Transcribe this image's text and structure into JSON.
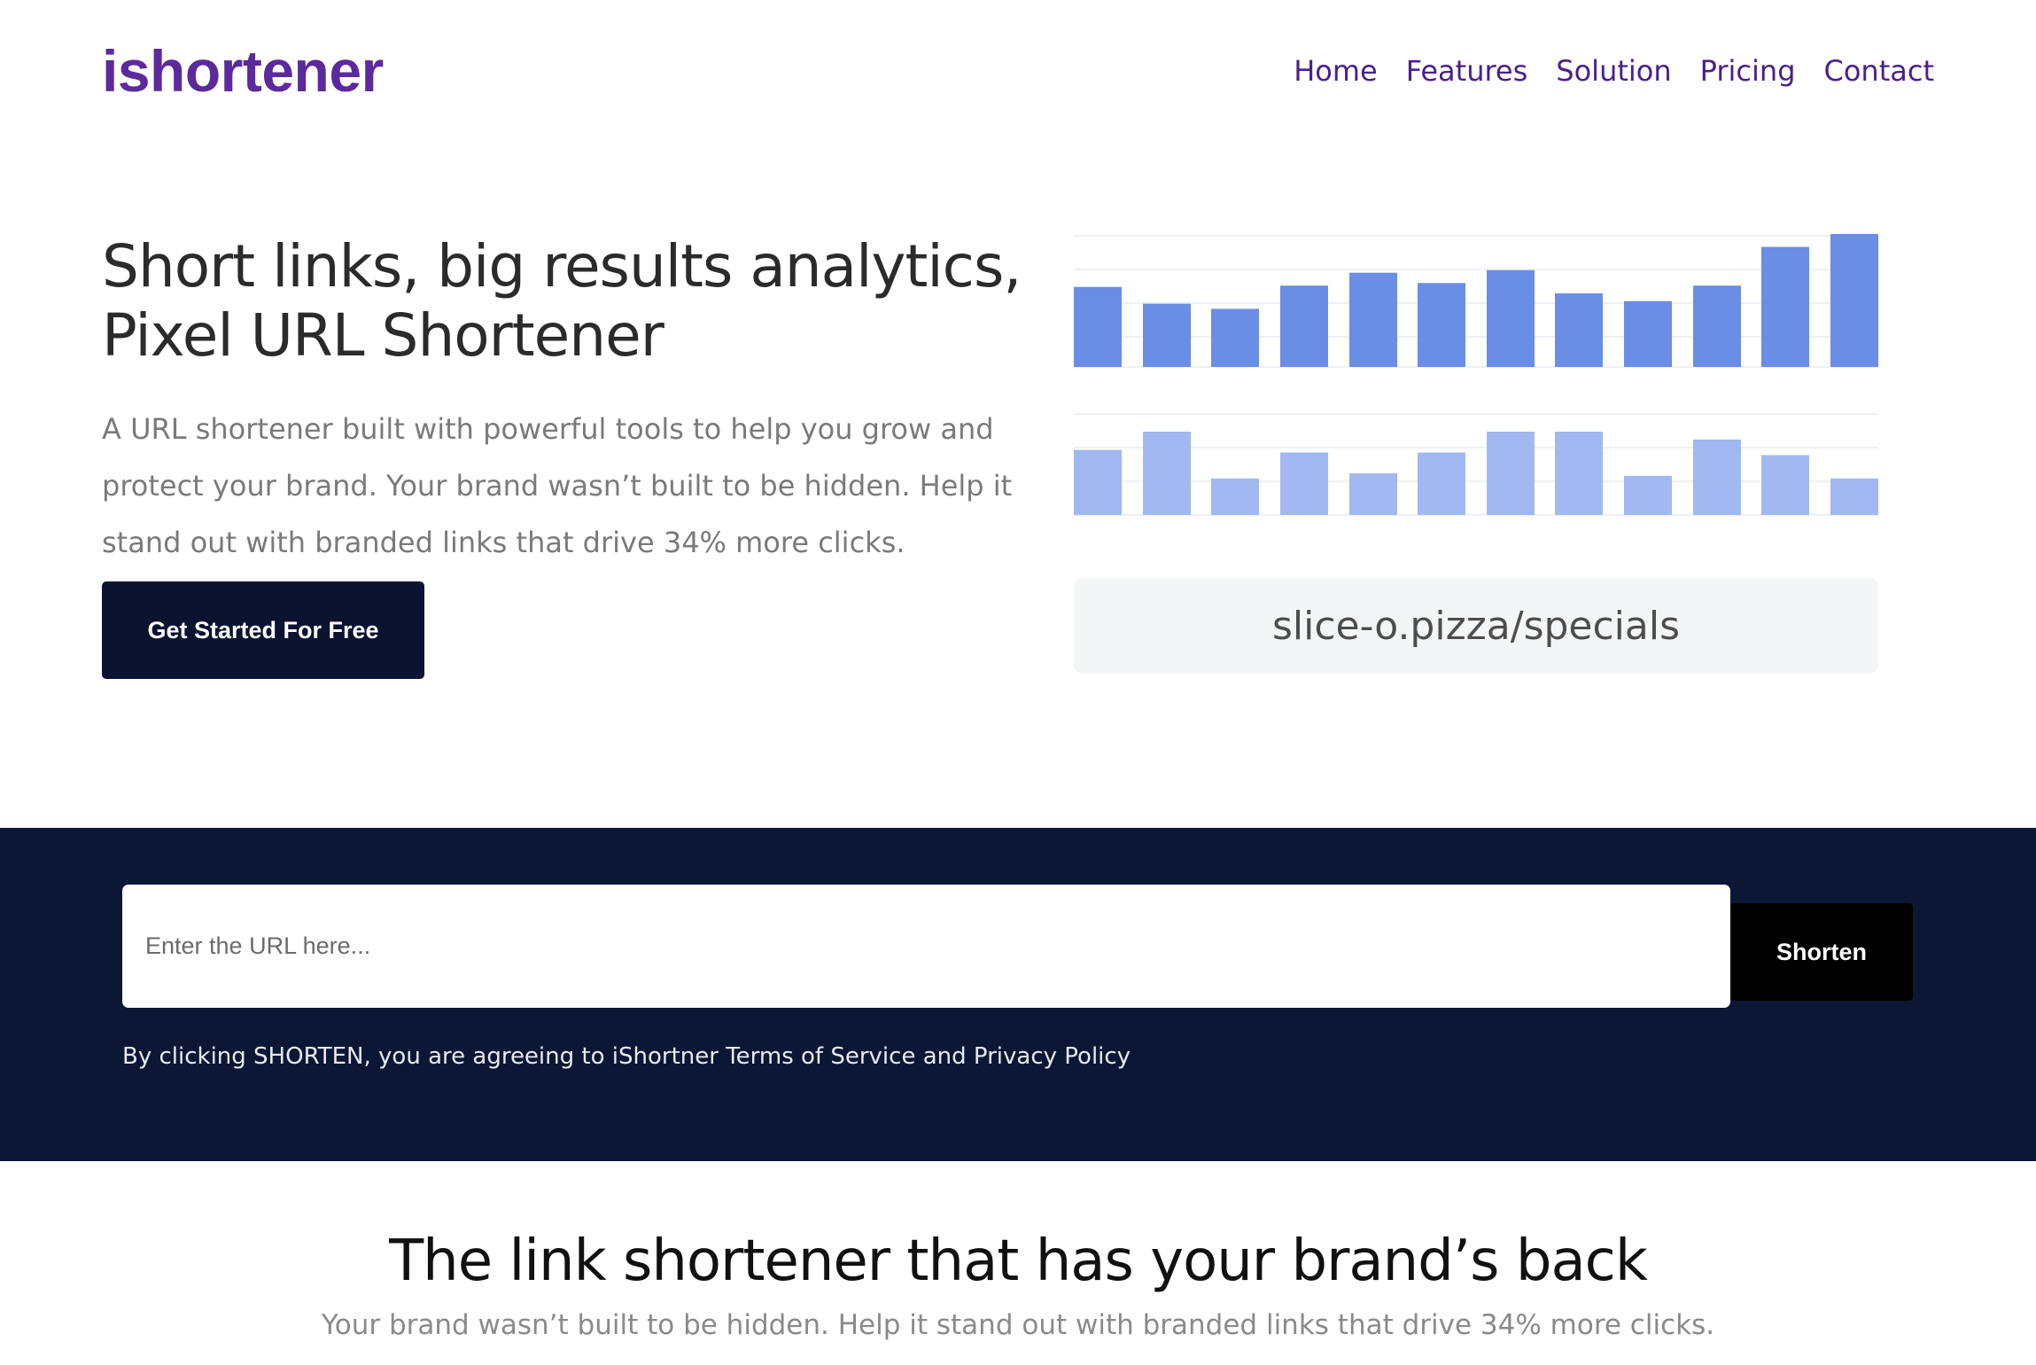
{
  "header": {
    "logo": "ishortener",
    "nav": [
      "Home",
      "Features",
      "Solution",
      "Pricing",
      "Contact"
    ]
  },
  "hero": {
    "title_line1": "Short links, big results analytics,",
    "title_line2": "Pixel URL Shortener",
    "description": "A URL shortener built with powerful tools to help you grow and protect your brand. Your brand wasn’t built to be hidden. Help it stand out with branded links that drive 34% more clicks.",
    "cta_label": "Get Started For Free"
  },
  "illustration": {
    "short_url": "slice-o.pizza/specials",
    "top_bars": [
      62,
      49,
      45,
      63,
      73,
      65,
      75,
      57,
      51,
      63,
      93,
      103
    ],
    "bottom_bars": [
      50,
      64,
      28,
      48,
      32,
      48,
      64,
      64,
      30,
      58,
      46,
      28
    ],
    "colors": {
      "top": "#6a8de6",
      "bottom": "#a2b8f1",
      "grid": "#eef0f4"
    }
  },
  "shortener": {
    "input_placeholder": "Enter the URL here...",
    "input_value": "",
    "button_label": "Shorten",
    "terms": "By clicking SHORTEN, you are agreeing to iShortner Terms of Service and Privacy Policy"
  },
  "section": {
    "title": "The link shortener that has your brand’s back",
    "subtitle": "Your brand wasn’t built to be hidden. Help it stand out with branded links that drive 34% more clicks."
  },
  "colors": {
    "brand": "#5b2a9c",
    "nav": "#4b1f8e",
    "band": "#0c1735",
    "cta": "#0c1330"
  }
}
